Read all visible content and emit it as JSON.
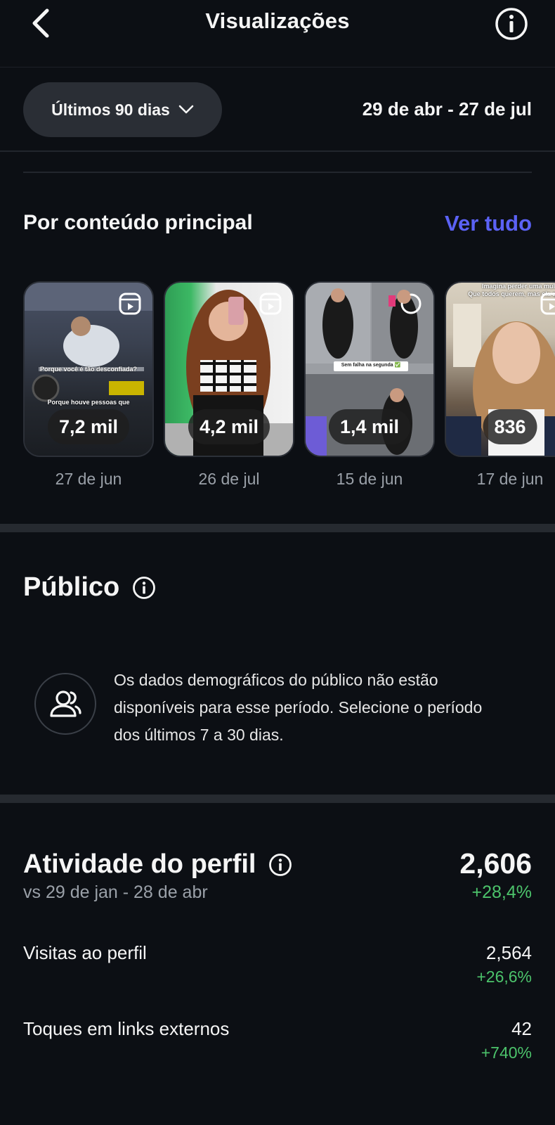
{
  "header": {
    "title": "Visualizações"
  },
  "filter": {
    "period_label": "Últimos 90 dias",
    "date_range": "29 de abr - 27 de jul"
  },
  "top_content": {
    "heading": "Por conteúdo principal",
    "see_all": "Ver tudo",
    "items": [
      {
        "views": "7,2 mil",
        "date": "27 de jun",
        "caption_top": "Porque você é tão desconfiada?",
        "caption_bottom": "Porque houve pessoas que"
      },
      {
        "views": "4,2 mil",
        "date": "26 de jul"
      },
      {
        "views": "1,4 mil",
        "date": "15 de jun",
        "caption_mid": "Sem falha na segunda ✅"
      },
      {
        "views": "836",
        "date": "17 de jun",
        "caption_top": "Imagina perder uma mulher",
        "caption_top2": "Que todos querem, mas ela quer"
      }
    ]
  },
  "audience": {
    "title": "Público",
    "message": "Os dados demográficos do público não estão disponíveis para esse período. Selecione o período dos últimos 7 a 30 dias."
  },
  "profile_activity": {
    "title": "Atividade do perfil",
    "comparison": "vs 29 de jan - 28 de abr",
    "total": "2,606",
    "total_change": "+28,4%",
    "metrics": [
      {
        "label": "Visitas ao perfil",
        "value": "2,564",
        "change": "+26,6%"
      },
      {
        "label": "Toques em links externos",
        "value": "42",
        "change": "+740%"
      }
    ]
  },
  "colors": {
    "background": "#0c0f14",
    "accent": "#5b62f5",
    "positive": "#4cc36b"
  }
}
